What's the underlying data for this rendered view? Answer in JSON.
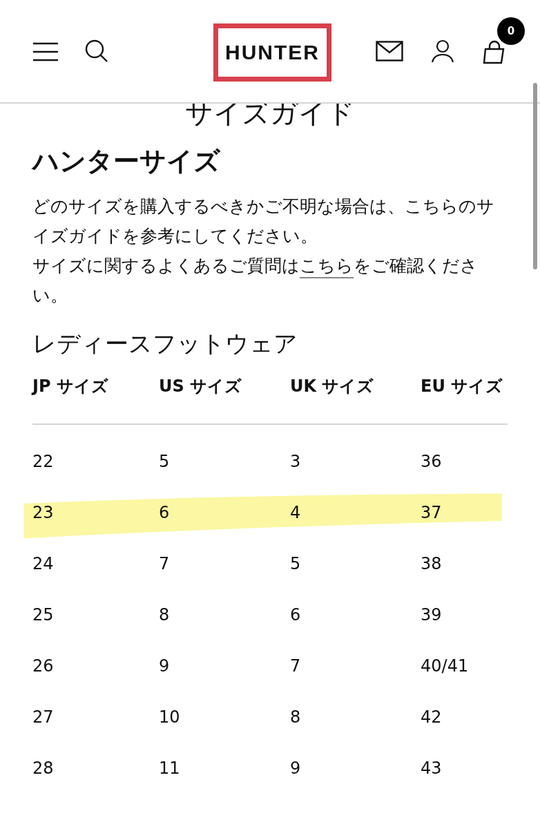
{
  "header": {
    "logo": "HUNTER",
    "cart_count": "0"
  },
  "page_title": "サイズガイド",
  "section_title": "ハンターサイズ",
  "intro": "どのサイズを購入するべきかご不明な場合は、こちらのサイズガイドを参考にしてください。",
  "faq": {
    "before": "サイズに関するよくあるご質問は",
    "link": "こちら",
    "after": "をご確認ください。"
  },
  "table_title": "レディースフットウェア",
  "columns": [
    "JP サイズ",
    "US サイズ",
    "UK サイズ",
    "EU サイズ"
  ],
  "rows": [
    {
      "cells": [
        "22",
        "5",
        "3",
        "36"
      ],
      "highlighted": false
    },
    {
      "cells": [
        "23",
        "6",
        "4",
        "37"
      ],
      "highlighted": true
    },
    {
      "cells": [
        "24",
        "7",
        "5",
        "38"
      ],
      "highlighted": false
    },
    {
      "cells": [
        "25",
        "8",
        "6",
        "39"
      ],
      "highlighted": false
    },
    {
      "cells": [
        "26",
        "9",
        "7",
        "40/41"
      ],
      "highlighted": false
    },
    {
      "cells": [
        "27",
        "10",
        "8",
        "42"
      ],
      "highlighted": false
    },
    {
      "cells": [
        "28",
        "11",
        "9",
        "43"
      ],
      "highlighted": false
    }
  ]
}
